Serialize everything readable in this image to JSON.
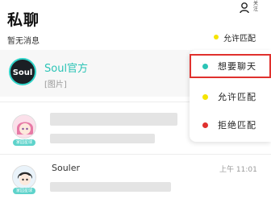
{
  "header": {
    "title": "私聊",
    "subtitle": "暂无消息",
    "follow_icon_label": "关注",
    "status_label": "允许匹配",
    "status_color": "#f5e400"
  },
  "chats": [
    {
      "name": "Soul官方",
      "last_message": "[图片]",
      "avatar_text": "Soul",
      "accent": "#2bc4b6"
    },
    {
      "name": "",
      "last_message": "",
      "badge": "家园星球"
    },
    {
      "name": "Souler",
      "time": "上午 11:01",
      "last_message": "",
      "badge": "家园星球"
    }
  ],
  "status_menu": {
    "items": [
      {
        "label": "想要聊天",
        "color": "#2bc4b6",
        "selected": true
      },
      {
        "label": "允许匹配",
        "color": "#f5e400",
        "selected": false
      },
      {
        "label": "拒绝匹配",
        "color": "#e0312e",
        "selected": false
      }
    ]
  }
}
